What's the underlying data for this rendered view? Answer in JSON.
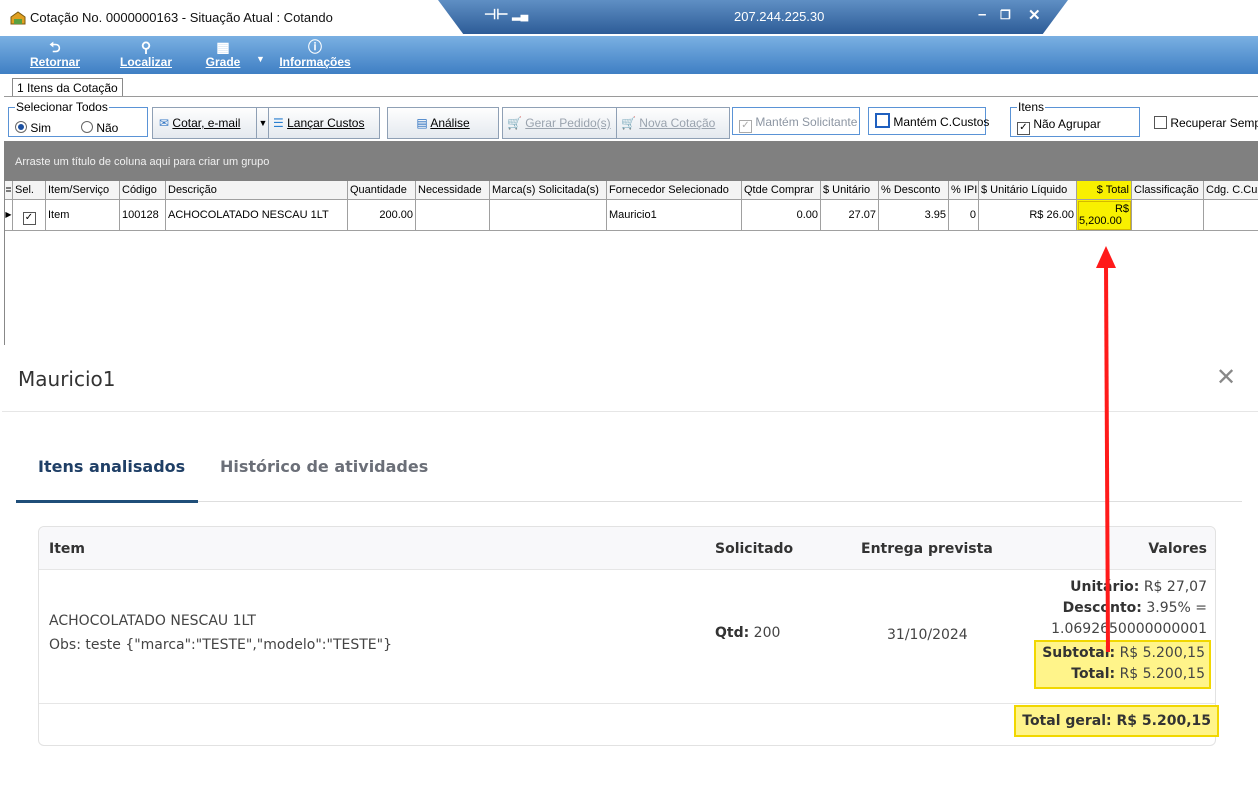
{
  "window": {
    "title": "Cotação No. 0000000163 - Situação Atual : Cotando",
    "remote_ip": "207.244.225.30"
  },
  "toolbar": {
    "retornar": "Retornar",
    "localizar": "Localizar",
    "grade": "Grade",
    "informacoes": "Informações"
  },
  "tabs": {
    "itens": "1 Itens da Cotação"
  },
  "options": {
    "selecionar_todos": "Selecionar Todos",
    "sim": "Sim",
    "nao": "Não",
    "cotar_email": "Cotar, e-mail",
    "lancar_custos": "Lançar Custos",
    "analise": "Análise",
    "gerar_pedido": "Gerar Pedido(s)",
    "nova_cotacao": "Nova Cotação",
    "mantem_solicitante": "Mantém Solicitante",
    "mantem_ccustos": "Mantém C.Custos",
    "itens_legend": "Itens",
    "nao_agrupar": "Não Agrupar",
    "recuperar": "Recuperar Semp"
  },
  "grid": {
    "group_hint": "Arraste um título de coluna aqui para criar um grupo",
    "headers": [
      "Sel.",
      "Item/Serviço",
      "Código",
      "Descrição",
      "Quantidade",
      "Necessidade",
      "Marca(s) Solicitada(s)",
      "Fornecedor Selecionado",
      "Qtde Comprar",
      "$ Unitário",
      "% Desconto",
      "% IPI",
      "$ Unitário Líquido",
      "$ Total",
      "Classificação",
      "Cdg. C.Cu"
    ],
    "row": {
      "item": "Item",
      "codigo": "100128",
      "descricao": "ACHOCOLATADO NESCAU 1LT",
      "quantidade": "200.00",
      "fornecedor": "Mauricio1",
      "qtde_comprar": "0.00",
      "unitario": "27.07",
      "desconto": "3.95",
      "ipi": "0",
      "unitario_liquido": "R$ 26.00",
      "total_line1": "R$",
      "total_line2": "5,200.00"
    }
  },
  "modal": {
    "title": "Mauricio1",
    "tab_active": "Itens analisados",
    "tab_other": "Histórico de atividades",
    "headers": {
      "item": "Item",
      "solicitado": "Solicitado",
      "entrega": "Entrega prevista",
      "valores": "Valores"
    },
    "item": {
      "name": "ACHOCOLATADO NESCAU 1LT",
      "obs": "Obs: teste {\"marca\":\"TESTE\",\"modelo\":\"TESTE\"}",
      "qtd_label": "Qtd:",
      "qtd_value": "200",
      "entrega": "31/10/2024",
      "unitario_label": "Unitário:",
      "unitario_value": "R$ 27,07",
      "desconto_label": "Desconto:",
      "desconto_value": "3.95% =",
      "desconto_calc": "1.0692650000000001",
      "subtotal_label": "Subtotal:",
      "subtotal_value": "R$ 5.200,15",
      "total_label": "Total:",
      "total_value": "R$ 5.200,15"
    },
    "total_geral": "Total geral: R$  5.200,15"
  },
  "colors": {
    "highlight": "#f8f000",
    "arrow": "#ff1a1a",
    "toolbar": "#3f7fc4"
  }
}
